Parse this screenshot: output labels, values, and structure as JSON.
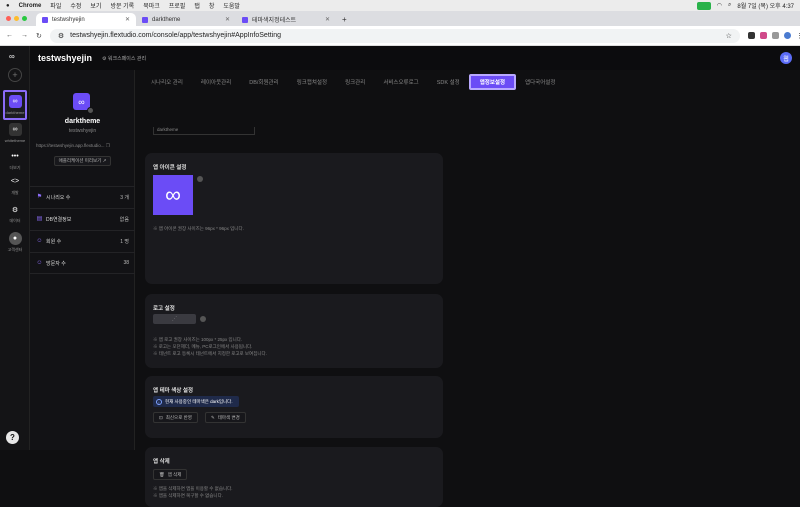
{
  "mac_menu": {
    "app": "Chrome",
    "items": [
      "파일",
      "수정",
      "보기",
      "방문 기록",
      "북마크",
      "프로필",
      "탭",
      "창",
      "도움말"
    ],
    "clock": "8월 7일 (목) 오후 4:37"
  },
  "browser": {
    "tabs": [
      {
        "label": "testwshyejin",
        "active": true
      },
      {
        "label": "darktheme",
        "active": false
      },
      {
        "label": "테마색지정테스트",
        "active": false
      }
    ],
    "new_tab": "+",
    "url": "testwshyejin.flextudio.com/console/app/testwshyejin#AppInfoSetting"
  },
  "rail": {
    "items": [
      {
        "label": "darktheme",
        "selected": true
      },
      {
        "label": "whitetheme"
      },
      {
        "label": "더보기"
      },
      {
        "label": "개발"
      },
      {
        "label": "데이터"
      },
      {
        "label": "고객센터"
      }
    ],
    "help": "?"
  },
  "header": {
    "title": "testwshyejin",
    "workspace": "워크스페이스 관리",
    "avatar": "웹"
  },
  "app_panel": {
    "name": "darktheme",
    "id": "testwshyejin",
    "link": "https://testwshyejin.app.flextudio...",
    "preview_button": "애플리케이션 미리보기",
    "stats": [
      {
        "label": "시나리오 수",
        "value": "3 개"
      },
      {
        "label": "DB연결정보",
        "value": "없음"
      },
      {
        "label": "회원 수",
        "value": "1 명"
      },
      {
        "label": "방문자 수",
        "value": "38"
      }
    ]
  },
  "nav_tabs": [
    "시나리오 관리",
    "레이아웃관리",
    "DB/회원관리",
    "링크캡쳐설정",
    "링크관리",
    "서비스오류로그",
    "SDK 설정",
    "앱정보설정",
    "앱다국어설정"
  ],
  "active_tab": "앱정보설정",
  "top_stub": "darktheme",
  "icon_card": {
    "title": "앱 아이콘 설정",
    "note": "※ 앱 아이콘 권장 사이즈는 96px * 96px 입니다."
  },
  "logo_card": {
    "title": "로고 설정",
    "notes": [
      "※ 앱 로고 권장 사이즈는 100px * 25px 입니다.",
      "※ 로고는 모던헤더, 메뉴, PC로그인에서 사용됩니다.",
      "※ 테넌트 로고 등록시 테넌트에서 지정한 로고로 보여집니다."
    ]
  },
  "theme_card": {
    "title": "앱 테마 색상 설정",
    "info": "현재 사용중인 테마색은 dark입니다.",
    "reset_button": "최신으로 반영",
    "change_button": "테마색 변경"
  },
  "delete_card": {
    "title": "앱 삭제",
    "button": "앱 삭제",
    "notes": [
      "※ 앱을 삭제하면 앱을 이용할 수 없습니다.",
      "※ 앱을 삭제하면 복구할 수 없습니다."
    ]
  },
  "colors": {
    "accent": "#6b4cf6",
    "selection": "#b9a9ff"
  }
}
